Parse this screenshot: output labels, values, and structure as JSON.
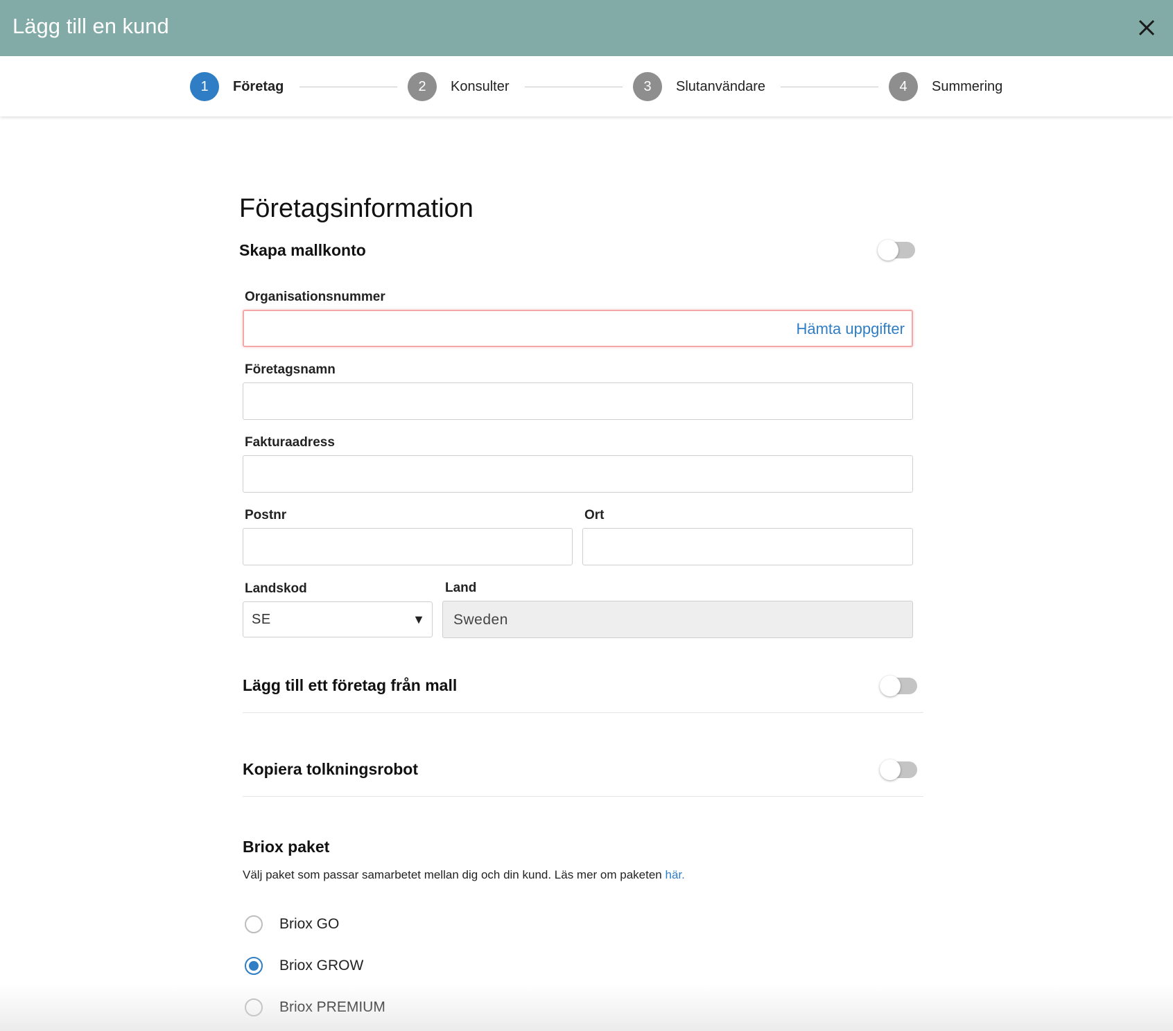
{
  "dialog": {
    "title": "Lägg till en kund"
  },
  "steps": [
    {
      "number": "1",
      "label": "Företag"
    },
    {
      "number": "2",
      "label": "Konsulter"
    },
    {
      "number": "3",
      "label": "Slutanvändare"
    },
    {
      "number": "4",
      "label": "Summering"
    }
  ],
  "form": {
    "section_title": "Företagsinformation",
    "template_account_label": "Skapa mallkonto",
    "org_number": {
      "label": "Organisationsnummer",
      "value": "",
      "action": "Hämta uppgifter"
    },
    "company_name": {
      "label": "Företagsnamn",
      "value": ""
    },
    "invoice_address": {
      "label": "Fakturaadress",
      "value": ""
    },
    "postal_code": {
      "label": "Postnr",
      "value": ""
    },
    "city": {
      "label": "Ort",
      "value": ""
    },
    "country_code": {
      "label": "Landskod",
      "value": "SE"
    },
    "country": {
      "label": "Land",
      "value": "Sweden"
    },
    "add_from_template_label": "Lägg till ett företag från mall",
    "copy_robot_label": "Kopiera tolkningsrobot"
  },
  "packages": {
    "title": "Briox paket",
    "description": "Välj paket som passar samarbetet mellan dig och din kund. Läs mer om paketen ",
    "description_link": "här.",
    "options": [
      {
        "label": "Briox GO",
        "selected": false
      },
      {
        "label": "Briox GROW",
        "selected": true
      },
      {
        "label": "Briox PREMIUM",
        "selected": false
      }
    ]
  },
  "colors": {
    "header": "#82aaa7",
    "accent": "#2f7ec5",
    "step_inactive": "#8e8e8e",
    "error_border": "#f3a7a7"
  }
}
